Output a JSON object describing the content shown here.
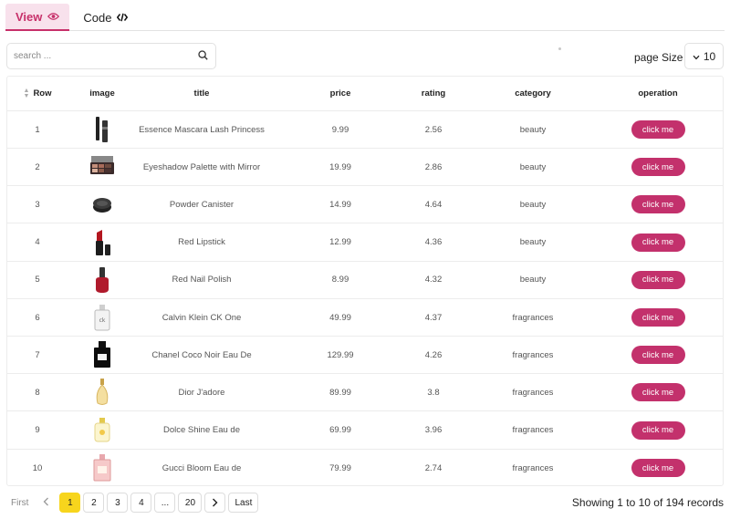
{
  "tabs": [
    {
      "label": "View",
      "icon": "eye-icon",
      "active": true
    },
    {
      "label": "Code",
      "icon": "code-icon",
      "active": false
    }
  ],
  "search": {
    "placeholder": "search ...",
    "value": ""
  },
  "page_size": {
    "label": "page Size",
    "value": "10"
  },
  "columns": [
    "Row",
    "image",
    "title",
    "price",
    "rating",
    "category",
    "operation"
  ],
  "rows": [
    {
      "row": "1",
      "image": "mascara-image",
      "title": "Essence Mascara Lash Princess",
      "price": "9.99",
      "rating": "2.56",
      "category": "beauty",
      "operation": "click me"
    },
    {
      "row": "2",
      "image": "eyeshadow-palette-image",
      "title": "Eyeshadow Palette with Mirror",
      "price": "19.99",
      "rating": "2.86",
      "category": "beauty",
      "operation": "click me"
    },
    {
      "row": "3",
      "image": "powder-canister-image",
      "title": "Powder Canister",
      "price": "14.99",
      "rating": "4.64",
      "category": "beauty",
      "operation": "click me"
    },
    {
      "row": "4",
      "image": "red-lipstick-image",
      "title": "Red Lipstick",
      "price": "12.99",
      "rating": "4.36",
      "category": "beauty",
      "operation": "click me"
    },
    {
      "row": "5",
      "image": "nail-polish-image",
      "title": "Red Nail Polish",
      "price": "8.99",
      "rating": "4.32",
      "category": "beauty",
      "operation": "click me"
    },
    {
      "row": "6",
      "image": "ck-one-bottle-image",
      "title": "Calvin Klein CK One",
      "price": "49.99",
      "rating": "4.37",
      "category": "fragrances",
      "operation": "click me"
    },
    {
      "row": "7",
      "image": "chanel-bottle-image",
      "title": "Chanel Coco Noir Eau De",
      "price": "129.99",
      "rating": "4.26",
      "category": "fragrances",
      "operation": "click me"
    },
    {
      "row": "8",
      "image": "dior-bottle-image",
      "title": "Dior J'adore",
      "price": "89.99",
      "rating": "3.8",
      "category": "fragrances",
      "operation": "click me"
    },
    {
      "row": "9",
      "image": "dolce-bottle-image",
      "title": "Dolce Shine Eau de",
      "price": "69.99",
      "rating": "3.96",
      "category": "fragrances",
      "operation": "click me"
    },
    {
      "row": "10",
      "image": "gucci-bottle-image",
      "title": "Gucci Bloom Eau de",
      "price": "79.99",
      "rating": "2.74",
      "category": "fragrances",
      "operation": "click me"
    }
  ],
  "pagination": {
    "first": "First",
    "last": "Last",
    "pages": [
      "1",
      "2",
      "3",
      "4",
      "...",
      "20"
    ],
    "current": "1"
  },
  "records_text": "Showing 1 to 10 of 194 records",
  "colors": {
    "accent": "#c3316c",
    "tab_bg": "#f8e1ec",
    "current_page": "#f7d51d"
  }
}
